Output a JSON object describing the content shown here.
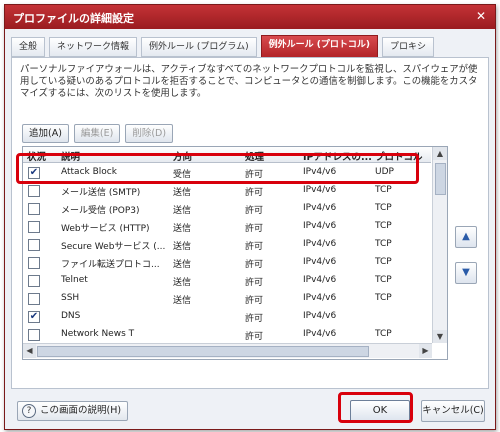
{
  "window": {
    "title": "プロファイルの詳細設定",
    "close_glyph": "✕"
  },
  "tabs": [
    {
      "label": "全般",
      "active": false
    },
    {
      "label": "ネットワーク情報",
      "active": false
    },
    {
      "label": "例外ルール (プログラム)",
      "active": false
    },
    {
      "label": "例外ルール (プロトコル)",
      "active": true
    },
    {
      "label": "プロキシ",
      "active": false
    }
  ],
  "description": "パーソナルファイアウォールは、アクティブなすべてのネットワークプロトコルを監視し、スパイウェアが使用している疑いのあるプロトコルを拒否することで、コンピュータとの通信を制御します。この機能をカスタマイズするには、次のリストを使用します。",
  "buttons": {
    "add": "追加(A)",
    "edit": "編集(E)",
    "delete": "削除(D)"
  },
  "table": {
    "columns": [
      "状況",
      "説明",
      "方向",
      "処理",
      "IPアドレスの...",
      "プロトコル"
    ],
    "rows": [
      {
        "checked": true,
        "desc": "Attack Block",
        "dir": "受信",
        "action": "許可",
        "ip": "IPv4/v6",
        "proto": "UDP"
      },
      {
        "checked": false,
        "desc": "メール送信 (SMTP)",
        "dir": "送信",
        "action": "許可",
        "ip": "IPv4/v6",
        "proto": "TCP"
      },
      {
        "checked": false,
        "desc": "メール受信 (POP3)",
        "dir": "送信",
        "action": "許可",
        "ip": "IPv4/v6",
        "proto": "TCP"
      },
      {
        "checked": false,
        "desc": "Webサービス (HTTP)",
        "dir": "送信",
        "action": "許可",
        "ip": "IPv4/v6",
        "proto": "TCP"
      },
      {
        "checked": false,
        "desc": "Secure Webサービス (...",
        "dir": "送信",
        "action": "許可",
        "ip": "IPv4/v6",
        "proto": "TCP"
      },
      {
        "checked": false,
        "desc": "ファイル転送プロトコ...",
        "dir": "送信",
        "action": "許可",
        "ip": "IPv4/v6",
        "proto": "TCP"
      },
      {
        "checked": false,
        "desc": "Telnet",
        "dir": "送信",
        "action": "許可",
        "ip": "IPv4/v6",
        "proto": "TCP"
      },
      {
        "checked": false,
        "desc": "SSH",
        "dir": "送信",
        "action": "許可",
        "ip": "IPv4/v6",
        "proto": "TCP"
      },
      {
        "checked": true,
        "desc": "DNS",
        "dir": "",
        "action": "許可",
        "ip": "IPv4/v6",
        "proto": ""
      },
      {
        "checked": false,
        "desc": "Network News T",
        "dir": "",
        "action": "許可",
        "ip": "IPv4/v6",
        "proto": "TCP"
      }
    ]
  },
  "footer": {
    "help": "この画面の説明(H)",
    "help_icon": "?",
    "ok": "OK",
    "cancel": "キャンセル(C)"
  },
  "glyphs": {
    "check": "✔",
    "up": "▲",
    "down": "▼",
    "left": "◀",
    "right": "▶"
  },
  "colors": {
    "accent": "#b22428",
    "highlight": "#d8000c"
  }
}
